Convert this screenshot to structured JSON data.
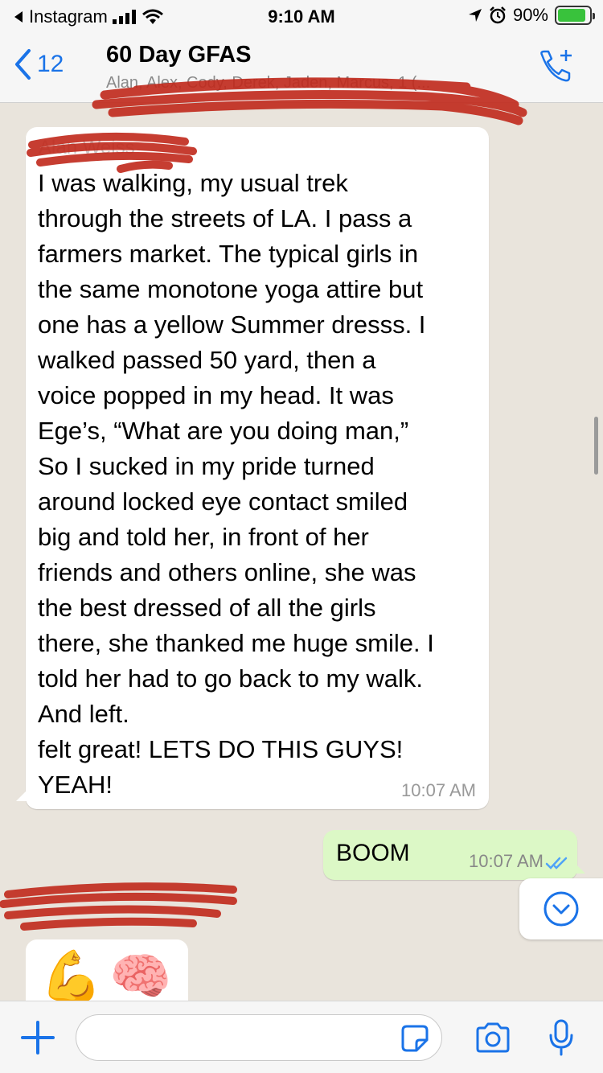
{
  "status_bar": {
    "back_app": "Instagram",
    "time": "9:10 AM",
    "battery": "90%",
    "battery_level": 0.9
  },
  "header": {
    "back_count": "12",
    "title": "60 Day GFAS",
    "subtitle": "Alan, Alex, Cody, Derek, Jaden, Marcus, 1 (..."
  },
  "messages": {
    "incoming": {
      "sender": "Alan Weiss",
      "text": "I was walking, my usual trek\nthrough the streets of LA. I pass a\nfarmers market. The typical girls in\nthe same monotone yoga attire but\none has a yellow Summer dresss. I\nwalked passed 50 yard, then a\nvoice popped in my head. It was\nEge’s, “What are you doing man,”\nSo I sucked in my pride turned\naround locked eye contact smiled\nbig and told her, in front of her\nfriends and others online, she was\nthe best dressed of all the girls\nthere, she thanked me huge smile. I\ntold her had to go back to my walk.\nAnd left.\nfelt great! LETS DO THIS GUYS!\nYEAH!",
      "time": "10:07 AM"
    },
    "outgoing": {
      "text": "BOOM",
      "time": "10:07 AM"
    },
    "emoji_message": {
      "emoji_1": "💪",
      "emoji_2": "🧠"
    }
  },
  "composer": {
    "placeholder": ""
  },
  "colors": {
    "accent": "#1a73e8",
    "outgoing_bubble": "#dcf8c6",
    "chat_background": "#e9e4dc",
    "scribble": "#c0281b"
  },
  "icons": [
    "back-chevron-icon",
    "signal-icon",
    "wifi-icon",
    "location-icon",
    "alarm-icon",
    "battery-icon",
    "add-call-icon",
    "double-check-icon",
    "chevron-down-icon",
    "plus-icon",
    "sticker-icon",
    "camera-icon",
    "mic-icon"
  ]
}
